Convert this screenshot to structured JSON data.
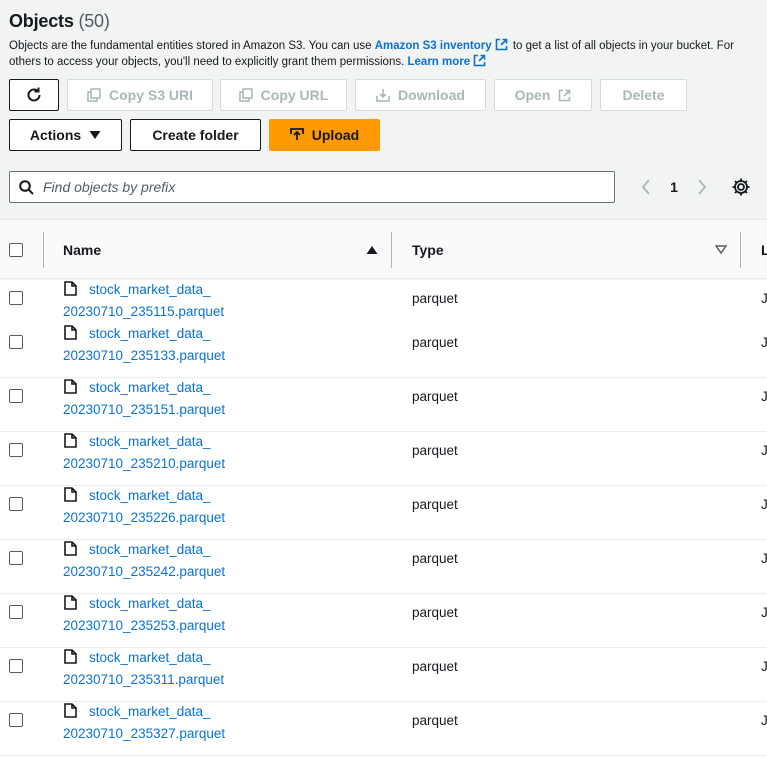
{
  "header": {
    "title": "Objects",
    "count": "(50)"
  },
  "description": {
    "part1": "Objects are the fundamental entities stored in Amazon S3. You can use ",
    "link1": "Amazon S3 inventory",
    "part2": " to get a list of all objects in your bucket. For others to access your objects, you'll need to explicitly grant them permissions. ",
    "link2": "Learn more"
  },
  "toolbar": {
    "copy_s3_uri": "Copy S3 URI",
    "copy_url": "Copy URL",
    "download": "Download",
    "open": "Open",
    "delete": "Delete",
    "actions": "Actions",
    "create_folder": "Create folder",
    "upload": "Upload"
  },
  "search": {
    "placeholder": "Find objects by prefix",
    "value": ""
  },
  "pagination": {
    "current_page": "1"
  },
  "table": {
    "columns": [
      "Name",
      "Type",
      "L"
    ],
    "rows": [
      {
        "name_line1": "stock_market_data_",
        "name_line2": "20230710_235115.parquet",
        "type": "parquet",
        "last": "J"
      },
      {
        "name_line1": "stock_market_data_",
        "name_line2": "20230710_235133.parquet",
        "type": "parquet",
        "last": "J"
      },
      {
        "name_line1": "stock_market_data_",
        "name_line2": "20230710_235151.parquet",
        "type": "parquet",
        "last": "J"
      },
      {
        "name_line1": "stock_market_data_",
        "name_line2": "20230710_235210.parquet",
        "type": "parquet",
        "last": "J"
      },
      {
        "name_line1": "stock_market_data_",
        "name_line2": "20230710_235226.parquet",
        "type": "parquet",
        "last": "J"
      },
      {
        "name_line1": "stock_market_data_",
        "name_line2": "20230710_235242.parquet",
        "type": "parquet",
        "last": "J"
      },
      {
        "name_line1": "stock_market_data_",
        "name_line2": "20230710_235253.parquet",
        "type": "parquet",
        "last": "J"
      },
      {
        "name_line1": "stock_market_data_",
        "name_line2": "20230710_235311.parquet",
        "type": "parquet",
        "last": "J"
      },
      {
        "name_line1": "stock_market_data_",
        "name_line2": "20230710_235327.parquet",
        "type": "parquet",
        "last": "J"
      }
    ]
  },
  "colors": {
    "link": "#0972d3",
    "primary": "#ff9900",
    "disabled": "#aab7b8",
    "border": "#16191f"
  }
}
